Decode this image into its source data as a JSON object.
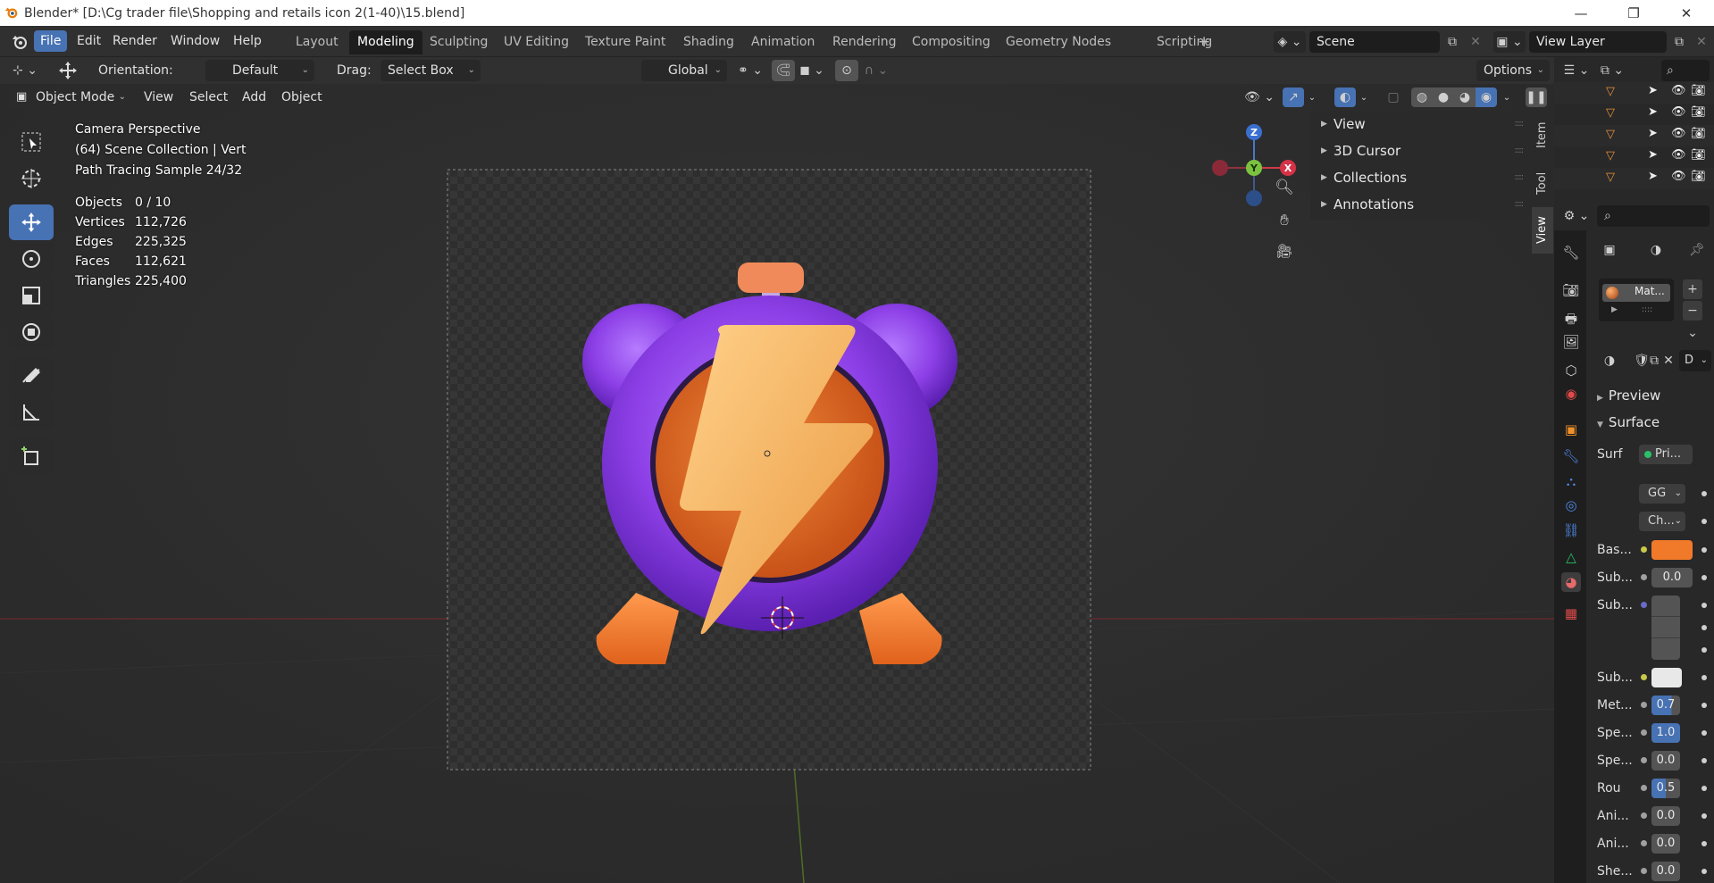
{
  "window": {
    "title": "Blender* [D:\\Cg trader file\\Shopping and retails icon 2(1-40)\\15.blend]",
    "minimize": "—",
    "maximize": "❐",
    "close": "✕"
  },
  "menu": {
    "items": [
      "File",
      "Edit",
      "Render",
      "Window",
      "Help"
    ],
    "active": "File"
  },
  "workspaces": {
    "tabs": [
      "Layout",
      "Modeling",
      "Sculpting",
      "UV Editing",
      "Texture Paint",
      "Shading",
      "Animation",
      "Rendering",
      "Compositing",
      "Geometry Nodes",
      "Scripting"
    ],
    "active": "Modeling",
    "add": "+"
  },
  "scene": {
    "name": "Scene",
    "view_layer": "View Layer"
  },
  "tool_header": {
    "orientation_label": "Orientation:",
    "orientation_value": "Default",
    "drag_label": "Drag:",
    "drag_value": "Select Box",
    "transform_orientation": "Global",
    "options": "Options"
  },
  "view_header": {
    "mode": "Object Mode",
    "menus": [
      "View",
      "Select",
      "Add",
      "Object"
    ]
  },
  "viewport_info": {
    "line1": "Camera Perspective",
    "line2": "(64) Scene Collection | Vert",
    "line3": "Path Tracing Sample 24/32",
    "stats": [
      {
        "label": "Objects",
        "value": "0 / 10"
      },
      {
        "label": "Vertices",
        "value": "112,726"
      },
      {
        "label": "Edges",
        "value": "225,325"
      },
      {
        "label": "Faces",
        "value": "112,621"
      },
      {
        "label": "Triangles",
        "value": "225,400"
      }
    ]
  },
  "gizmo": {
    "x": "X",
    "y": "Y",
    "z": "Z"
  },
  "npanel": {
    "sections": [
      "View",
      "3D Cursor",
      "Collections",
      "Annotations"
    ],
    "tabs": [
      "Item",
      "Tool",
      "View"
    ],
    "active_tab": "View"
  },
  "properties": {
    "material_slot": "Mat...",
    "browse_value": "D",
    "preview_label": "Preview",
    "surface_label": "Surface",
    "surface_field": "Surf",
    "surface_value": "Pri...",
    "dist_value": "GG",
    "sss_method_value": "Ch...",
    "rows": [
      {
        "label": "Bas...",
        "value": "",
        "kind": "color",
        "color": "#f07a2a"
      },
      {
        "label": "Sub...",
        "value": "0.0",
        "kind": "num"
      },
      {
        "label": "Sub...",
        "value": "",
        "kind": "vector"
      },
      {
        "label": "Sub...",
        "value": "",
        "kind": "color",
        "color": "#e8e8e8"
      },
      {
        "label": "Met...",
        "value": "0.7",
        "kind": "blue"
      },
      {
        "label": "Spe...",
        "value": "1.0",
        "kind": "blue2"
      },
      {
        "label": "Spe...",
        "value": "0.0",
        "kind": "num"
      },
      {
        "label": "Rou",
        "value": "0.5",
        "kind": "blue"
      },
      {
        "label": "Ani...",
        "value": "0.0",
        "kind": "num"
      },
      {
        "label": "Ani...",
        "value": "0.0",
        "kind": "num"
      },
      {
        "label": "She...",
        "value": "0.0",
        "kind": "num"
      }
    ]
  },
  "colors": {
    "accent": "#4772b3",
    "clock_purple": "#8c3fe6",
    "clock_orange": "#f07a2a",
    "bolt": "#f7b25a"
  }
}
